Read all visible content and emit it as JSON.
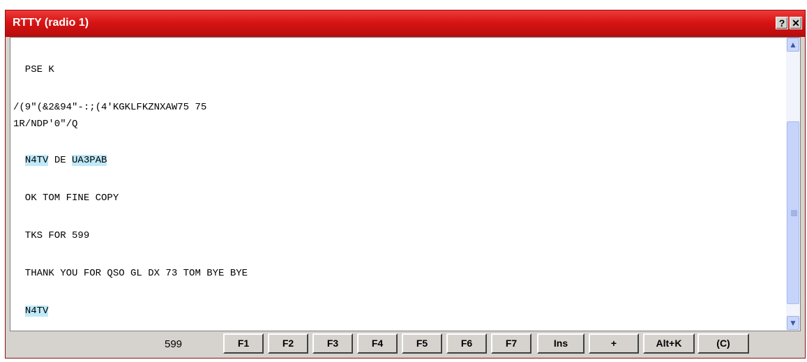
{
  "window": {
    "title": "RTTY (radio 1)",
    "help_label": "?",
    "close_label": "✕"
  },
  "receive": {
    "lines": [
      {
        "text": "  PSE K"
      },
      {
        "text": "/(9\"(&2&94\"-:;(4'KGKLFKZNXAW75 75"
      },
      {
        "text": "1R/NDP'0\"/Q"
      },
      {
        "pre": "  ",
        "call1": "N4TV",
        "mid": " DE ",
        "call2": "UA3PAB"
      },
      {
        "text": "  OK TOM FINE COPY"
      },
      {
        "text": "  TKS FOR 599"
      },
      {
        "text": "  THANK YOU FOR QSO GL DX 73 TOM BYE BYE"
      },
      {
        "pre": "  ",
        "call1": "N4TV"
      }
    ]
  },
  "scrollbar": {
    "up_icon": "▲",
    "down_icon": "▼"
  },
  "bottom_bar": {
    "rst_value": "599",
    "keys": [
      "F1",
      "F2",
      "F3",
      "F4",
      "F5",
      "F6",
      "F7",
      "Ins",
      "+",
      "Alt+K",
      "(C)"
    ]
  },
  "colors": {
    "titlebar": "#d71414",
    "callsign_highlight": "#bfe9f8",
    "scrollbar_thumb": "#c6d4fb"
  }
}
